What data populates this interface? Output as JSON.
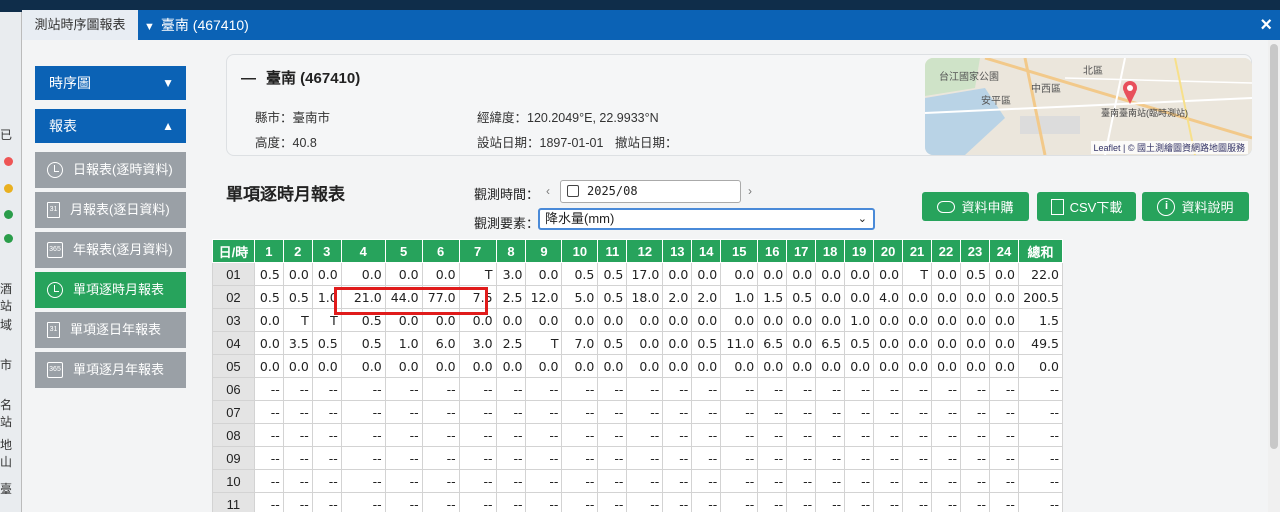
{
  "tabs": {
    "inactive_label": "測站時序圖報表",
    "active_label": "臺南 (467410)"
  },
  "bg_fragments": [
    "已",
    "酒站",
    "域",
    "市",
    "名站",
    "地山",
    "臺"
  ],
  "sidebar": {
    "sections": [
      {
        "label": "時序圖",
        "arrow": "▼"
      },
      {
        "label": "報表",
        "arrow": "▲"
      }
    ],
    "items": [
      {
        "label": "日報表(逐時資料)",
        "icon": "clock-icon",
        "icon_text": "",
        "active": false
      },
      {
        "label": "月報表(逐日資料)",
        "icon": "calendar-31-icon",
        "icon_text": "31",
        "active": false
      },
      {
        "label": "年報表(逐月資料)",
        "icon": "calendar-365-icon",
        "icon_text": "365",
        "active": false
      },
      {
        "label": "單項逐時月報表",
        "icon": "clock-icon",
        "icon_text": "",
        "active": true
      },
      {
        "label": "單項逐日年報表",
        "icon": "calendar-31-icon",
        "icon_text": "31",
        "active": false
      },
      {
        "label": "單項逐月年報表",
        "icon": "calendar-365-icon",
        "icon_text": "365",
        "active": false
      }
    ]
  },
  "station": {
    "title": "臺南 (467410)",
    "county": "縣市：臺南市",
    "altitude": "高度：40.8",
    "coords": "經緯度：120.2049°E, 22.9933°N",
    "established": "設站日期：1897-01-01",
    "closed": "撤站日期："
  },
  "map": {
    "labels": [
      "北區",
      "中西區",
      "安平區",
      "臺南臺南站(臨時測站)",
      "台江國家公園"
    ],
    "attribution": "Leaflet | © 國土測繪圖資網路地圖服務"
  },
  "report": {
    "title": "單項逐時月報表",
    "time_label": "觀測時間：",
    "time_value": "2025/08",
    "element_label": "觀測要素：",
    "element_value": "降水量(mm)"
  },
  "buttons": {
    "apply": "資料申購",
    "csv": "CSV下載",
    "info": "資料說明"
  },
  "table": {
    "corner": "日/時",
    "hours": [
      "1",
      "2",
      "3",
      "4",
      "5",
      "6",
      "7",
      "8",
      "9",
      "10",
      "11",
      "12",
      "13",
      "14",
      "15",
      "16",
      "17",
      "18",
      "19",
      "20",
      "21",
      "22",
      "23",
      "24"
    ],
    "total_label": "總和",
    "rows": [
      {
        "day": "01",
        "vals": [
          "0.5",
          "0.0",
          "0.0",
          "0.0",
          "0.0",
          "0.0",
          "T",
          "3.0",
          "0.0",
          "0.5",
          "0.5",
          "17.0",
          "0.0",
          "0.0",
          "0.0",
          "0.0",
          "0.0",
          "0.0",
          "0.0",
          "0.0",
          "T",
          "0.0",
          "0.5",
          "0.0"
        ],
        "total": "22.0"
      },
      {
        "day": "02",
        "vals": [
          "0.5",
          "0.5",
          "1.0",
          "21.0",
          "44.0",
          "77.0",
          "7.5",
          "2.5",
          "12.0",
          "5.0",
          "0.5",
          "18.0",
          "2.0",
          "2.0",
          "1.0",
          "1.5",
          "0.5",
          "0.0",
          "0.0",
          "4.0",
          "0.0",
          "0.0",
          "0.0",
          "0.0"
        ],
        "total": "200.5"
      },
      {
        "day": "03",
        "vals": [
          "0.0",
          "T",
          "T",
          "0.5",
          "0.0",
          "0.0",
          "0.0",
          "0.0",
          "0.0",
          "0.0",
          "0.0",
          "0.0",
          "0.0",
          "0.0",
          "0.0",
          "0.0",
          "0.0",
          "0.0",
          "1.0",
          "0.0",
          "0.0",
          "0.0",
          "0.0",
          "0.0"
        ],
        "total": "1.5"
      },
      {
        "day": "04",
        "vals": [
          "0.0",
          "3.5",
          "0.5",
          "0.5",
          "1.0",
          "6.0",
          "3.0",
          "2.5",
          "T",
          "7.0",
          "0.5",
          "0.0",
          "0.0",
          "0.5",
          "11.0",
          "6.5",
          "0.0",
          "6.5",
          "0.5",
          "0.0",
          "0.0",
          "0.0",
          "0.0",
          "0.0"
        ],
        "total": "49.5"
      },
      {
        "day": "05",
        "vals": [
          "0.0",
          "0.0",
          "0.0",
          "0.0",
          "0.0",
          "0.0",
          "0.0",
          "0.0",
          "0.0",
          "0.0",
          "0.0",
          "0.0",
          "0.0",
          "0.0",
          "0.0",
          "0.0",
          "0.0",
          "0.0",
          "0.0",
          "0.0",
          "0.0",
          "0.0",
          "0.0",
          "0.0"
        ],
        "total": "0.0"
      },
      {
        "day": "06",
        "vals": [
          "--",
          "--",
          "--",
          "--",
          "--",
          "--",
          "--",
          "--",
          "--",
          "--",
          "--",
          "--",
          "--",
          "--",
          "--",
          "--",
          "--",
          "--",
          "--",
          "--",
          "--",
          "--",
          "--",
          "--"
        ],
        "total": "--"
      },
      {
        "day": "07",
        "vals": [
          "--",
          "--",
          "--",
          "--",
          "--",
          "--",
          "--",
          "--",
          "--",
          "--",
          "--",
          "--",
          "--",
          "--",
          "--",
          "--",
          "--",
          "--",
          "--",
          "--",
          "--",
          "--",
          "--",
          "--"
        ],
        "total": "--"
      },
      {
        "day": "08",
        "vals": [
          "--",
          "--",
          "--",
          "--",
          "--",
          "--",
          "--",
          "--",
          "--",
          "--",
          "--",
          "--",
          "--",
          "--",
          "--",
          "--",
          "--",
          "--",
          "--",
          "--",
          "--",
          "--",
          "--",
          "--"
        ],
        "total": "--"
      },
      {
        "day": "09",
        "vals": [
          "--",
          "--",
          "--",
          "--",
          "--",
          "--",
          "--",
          "--",
          "--",
          "--",
          "--",
          "--",
          "--",
          "--",
          "--",
          "--",
          "--",
          "--",
          "--",
          "--",
          "--",
          "--",
          "--",
          "--"
        ],
        "total": "--"
      },
      {
        "day": "10",
        "vals": [
          "--",
          "--",
          "--",
          "--",
          "--",
          "--",
          "--",
          "--",
          "--",
          "--",
          "--",
          "--",
          "--",
          "--",
          "--",
          "--",
          "--",
          "--",
          "--",
          "--",
          "--",
          "--",
          "--",
          "--"
        ],
        "total": "--"
      },
      {
        "day": "11",
        "vals": [
          "--",
          "--",
          "--",
          "--",
          "--",
          "--",
          "--",
          "--",
          "--",
          "--",
          "--",
          "--",
          "--",
          "--",
          "--",
          "--",
          "--",
          "--",
          "--",
          "--",
          "--",
          "--",
          "--",
          "--"
        ],
        "total": "--"
      }
    ]
  },
  "colors": {
    "brand_blue": "#0b62b5",
    "green": "#27a35c",
    "highlight_red": "#e01b1b"
  }
}
